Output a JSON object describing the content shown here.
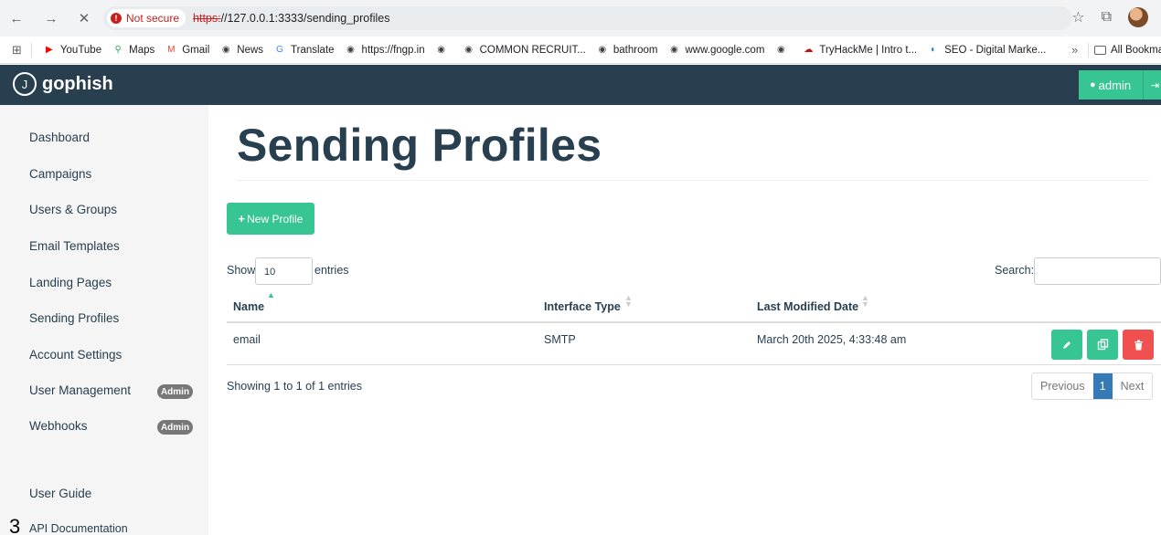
{
  "browser": {
    "back": "←",
    "forward": "→",
    "close": "✕",
    "security_label": "Not secure",
    "url_scheme": "https:",
    "url_rest": "//127.0.0.1:3333/sending_profiles",
    "bookmarks": [
      {
        "label": "YouTube",
        "icon": "youtube-icon",
        "color": "#ff0000"
      },
      {
        "label": "Maps",
        "icon": "maps-icon",
        "color": "#34a853"
      },
      {
        "label": "Gmail",
        "icon": "gmail-icon",
        "color": "#ea4335"
      },
      {
        "label": "News",
        "icon": "globe-icon",
        "color": "#3c4043"
      },
      {
        "label": "Translate",
        "icon": "translate-icon",
        "color": "#4285f4"
      },
      {
        "label": "https://fngp.in",
        "icon": "globe-icon",
        "color": "#3c4043"
      },
      {
        "label": "",
        "icon": "globe-icon",
        "color": "#3c4043"
      },
      {
        "label": "COMMON RECRUIT...",
        "icon": "globe-icon",
        "color": "#3c4043"
      },
      {
        "label": "bathroom",
        "icon": "globe-icon",
        "color": "#3c4043"
      },
      {
        "label": "www.google.com",
        "icon": "globe-icon",
        "color": "#3c4043"
      },
      {
        "label": "",
        "icon": "globe-icon",
        "color": "#3c4043"
      },
      {
        "label": "TryHackMe | Intro t...",
        "icon": "tryhackme-icon",
        "color": "#c11111"
      },
      {
        "label": "SEO - Digital Marke...",
        "icon": "seo-icon",
        "color": "#1a73e8"
      }
    ],
    "more_bookmarks": "»",
    "all_bookmarks": "All Bookmarl"
  },
  "navbar": {
    "brand": "gophish",
    "user": "admin"
  },
  "sidebar": {
    "items": [
      {
        "label": "Dashboard"
      },
      {
        "label": "Campaigns"
      },
      {
        "label": "Users & Groups"
      },
      {
        "label": "Email Templates"
      },
      {
        "label": "Landing Pages"
      },
      {
        "label": "Sending Profiles"
      },
      {
        "label": "Account Settings"
      },
      {
        "label": "User Management",
        "badge": "Admin"
      },
      {
        "label": "Webhooks",
        "badge": "Admin"
      }
    ],
    "user_guide": "User Guide",
    "api_docs": "API Documentation",
    "step_number": "3"
  },
  "main": {
    "title": "Sending Profiles",
    "new_button": "New Profile",
    "show_label": "Show",
    "entries_value": "10",
    "entries_label": "entries",
    "search_label": "Search:",
    "columns": [
      "Name",
      "Interface Type",
      "Last Modified Date"
    ],
    "rows": [
      {
        "name": "email",
        "interface_type": "SMTP",
        "modified": "March 20th 2025, 4:33:48 am"
      }
    ],
    "info": "Showing 1 to 1 of 1 entries",
    "pagination": {
      "previous": "Previous",
      "current": "1",
      "next": "Next"
    }
  },
  "colors": {
    "navbar": "#283f50",
    "accent_green": "#37c593",
    "danger_red": "#f05050",
    "page_active": "#337ab7"
  }
}
